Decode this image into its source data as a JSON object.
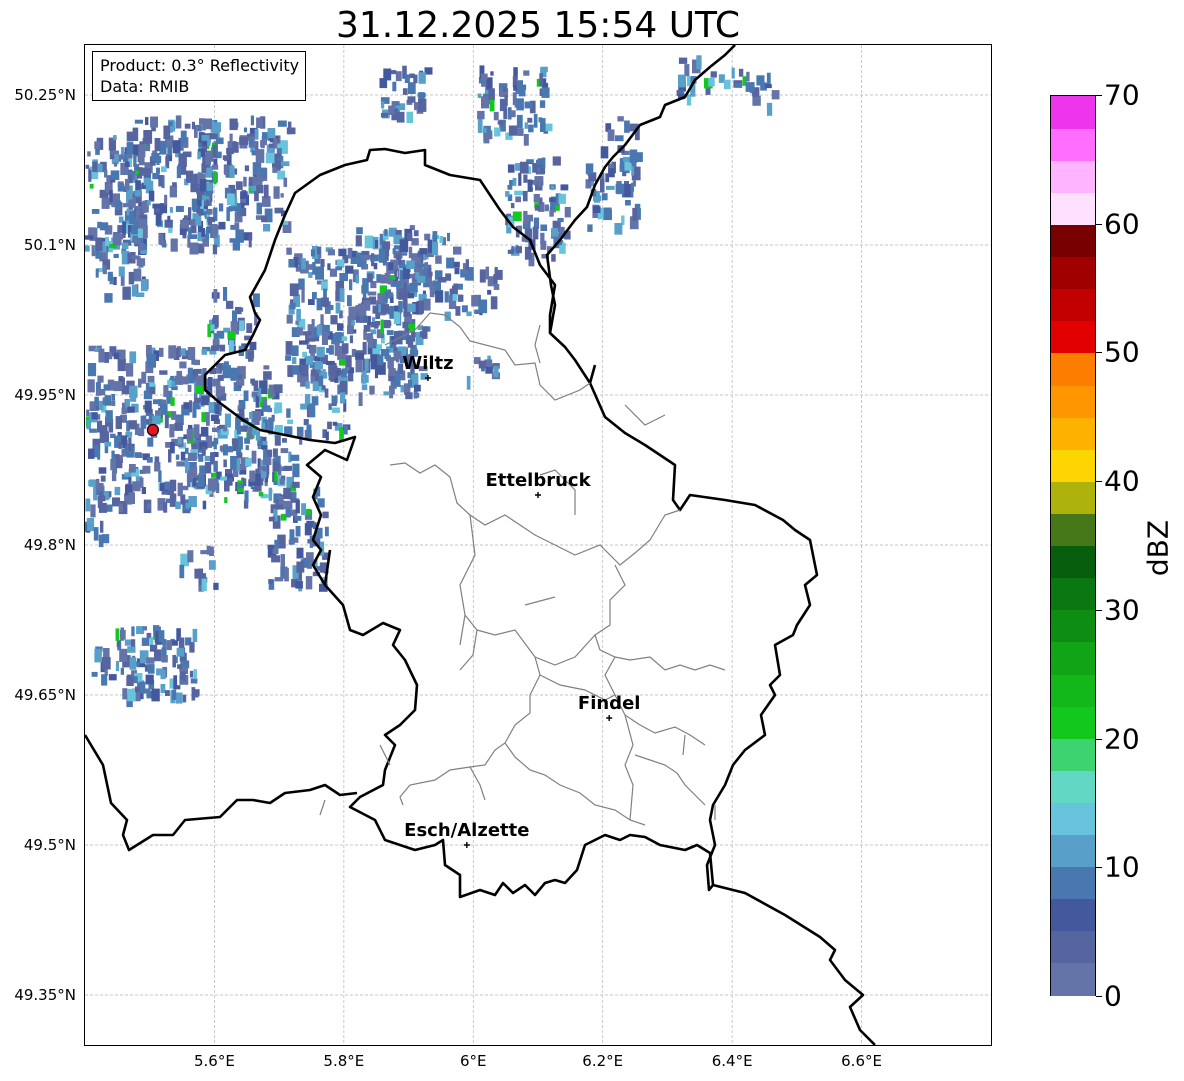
{
  "title": "31.12.2025 15:54 UTC",
  "info": {
    "product": "Product: 0.3° Reflectivity",
    "data_source": "Data: RMIB"
  },
  "y_ticks": [
    "50.25°N",
    "50.1°N",
    "49.95°N",
    "49.8°N",
    "49.65°N",
    "49.5°N",
    "49.35°N"
  ],
  "x_ticks": [
    "5.6°E",
    "5.8°E",
    "6°E",
    "6.2°E",
    "6.4°E",
    "6.6°E"
  ],
  "extent": {
    "lon_min": 5.4,
    "lon_max": 6.8,
    "lat_min": 49.3,
    "lat_max": 50.3
  },
  "cities": [
    {
      "name": "Wiltz",
      "lon": 5.93,
      "lat": 49.967
    },
    {
      "name": "Ettelbruck",
      "lon": 6.1,
      "lat": 49.85
    },
    {
      "name": "Findel",
      "lon": 6.21,
      "lat": 49.627
    },
    {
      "name": "Esch/Alzette",
      "lon": 5.99,
      "lat": 49.5
    }
  ],
  "radar_site": {
    "lon": 5.505,
    "lat": 49.915,
    "color": "#e8141e"
  },
  "colorbar": {
    "label": "dBZ",
    "ticks": [
      "0",
      "10",
      "20",
      "30",
      "40",
      "50",
      "60",
      "70"
    ],
    "range": [
      0,
      70
    ],
    "colors": [
      "#6473a8",
      "#56659f",
      "#44589e",
      "#4978b0",
      "#589fca",
      "#68c3dc",
      "#62d7c3",
      "#3ed371",
      "#12c81c",
      "#12b81a",
      "#10a416",
      "#0d8d14",
      "#0b7711",
      "#075e0c",
      "#46781a",
      "#adb30b",
      "#fdd500",
      "#fdb200",
      "#fe9600",
      "#fd7d00",
      "#e20000",
      "#c20000",
      "#a00000",
      "#780000",
      "#ffe1ff",
      "#ffb4ff",
      "#ff6eff",
      "#ed35ed"
    ]
  }
}
